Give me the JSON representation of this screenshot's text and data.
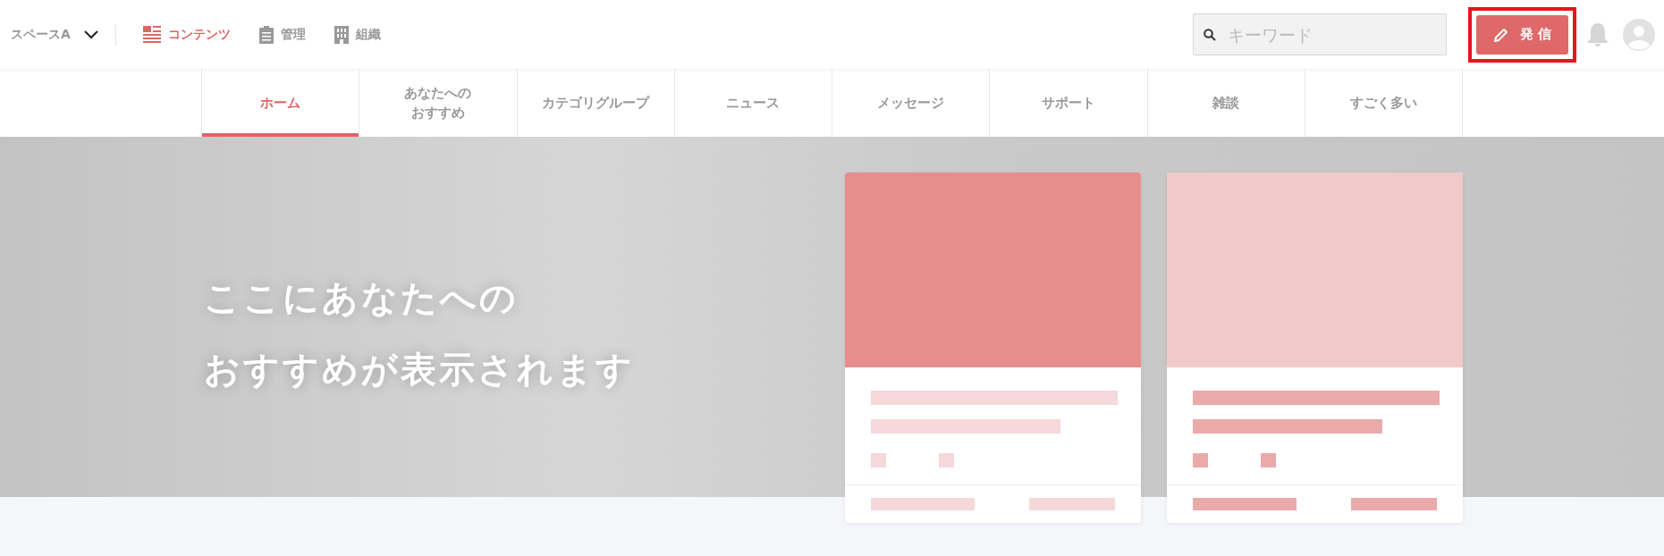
{
  "header": {
    "space_selector": {
      "label": "スペースA"
    },
    "nav": [
      {
        "label": "コンテンツ",
        "selected": true
      },
      {
        "label": "管理",
        "selected": false
      },
      {
        "label": "組織",
        "selected": false
      }
    ],
    "search": {
      "placeholder": "キーワード"
    },
    "post_button": {
      "label": "発 信",
      "highlighted": true
    }
  },
  "tabs": [
    {
      "label_lines": [
        "ホーム"
      ],
      "selected": true
    },
    {
      "label_lines": [
        "あなたへの",
        "おすすめ"
      ],
      "selected": false
    },
    {
      "label_lines": [
        "カテゴリグループ"
      ],
      "selected": false
    },
    {
      "label_lines": [
        "ニュース"
      ],
      "selected": false
    },
    {
      "label_lines": [
        "メッセージ"
      ],
      "selected": false
    },
    {
      "label_lines": [
        "サポート"
      ],
      "selected": false
    },
    {
      "label_lines": [
        "雑談"
      ],
      "selected": false
    },
    {
      "label_lines": [
        "すごく多い"
      ],
      "selected": false
    }
  ],
  "hero": {
    "message_lines": [
      "ここにあなたへの",
      "おすすめが表示されます"
    ],
    "cards": [
      {
        "kind": "placeholder",
        "color": "#e68e8c"
      },
      {
        "kind": "placeholder",
        "color": "#f1c9c9"
      }
    ]
  }
}
